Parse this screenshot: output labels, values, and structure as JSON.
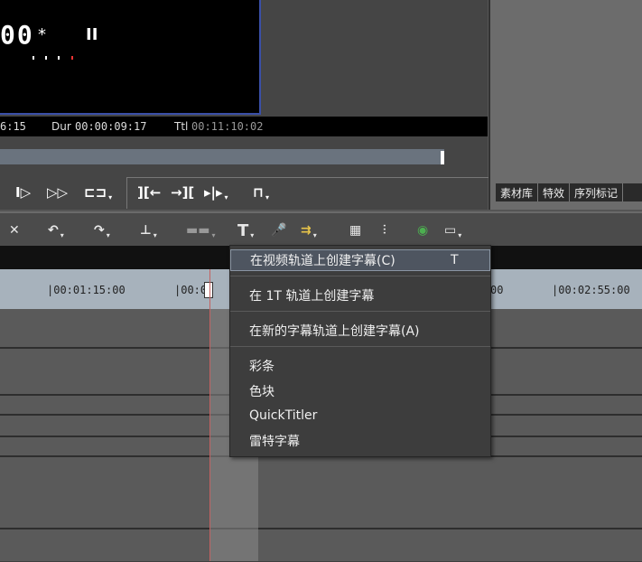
{
  "preview": {
    "timecode_partial": "00",
    "star": "*",
    "pause": "II",
    "status": {
      "current_tc": "6:15",
      "dur_label": "Dur",
      "dur_value": "00:00:09:17",
      "ttl_label": "Ttl",
      "ttl_value": "00:11:10:02"
    },
    "transport": {
      "play_step": "I▷",
      "fast_forward": "▷▷",
      "loop": "⊏⊐",
      "caret": "▾",
      "mark_in": "][←",
      "mark_out": "→][",
      "split": "▸|▸",
      "more": "⊓"
    }
  },
  "right_panel": {
    "tabs": [
      "素材库",
      "特效",
      "序列标记"
    ]
  },
  "toolbar": {
    "delete": "✕",
    "undo": "↶",
    "redo": "↷",
    "trim": "⊥",
    "split": "▬▬",
    "title": "T",
    "mic": "🎤",
    "export": "⇉",
    "grid": "▦",
    "mixer": "⫶",
    "color": "◉",
    "screen": "▭"
  },
  "timeline": {
    "ruler_labels": [
      "|00:01:15:00",
      "|00:0",
      "00",
      "|00:02:55:00"
    ]
  },
  "context_menu": {
    "items": [
      {
        "label": "在视频轨道上创建字幕(C)",
        "shortcut": "T"
      },
      {
        "label": "在 1T 轨道上创建字幕",
        "shortcut": ""
      },
      {
        "label": "在新的字幕轨道上创建字幕(A)",
        "shortcut": ""
      },
      {
        "label": "彩条",
        "shortcut": ""
      },
      {
        "label": "色块",
        "shortcut": ""
      },
      {
        "label": "QuickTitler",
        "shortcut": ""
      },
      {
        "label": "雷特字幕",
        "shortcut": ""
      }
    ]
  }
}
